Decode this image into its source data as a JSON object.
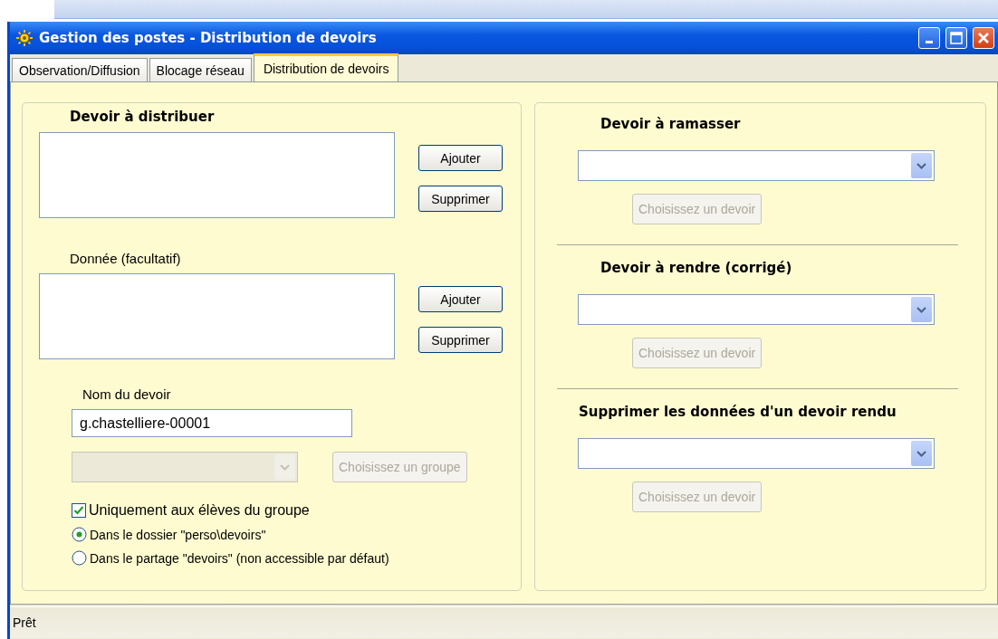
{
  "window": {
    "title": "Gestion des postes - Distribution de devoirs"
  },
  "tabs": [
    {
      "label": "Observation/Diffusion",
      "selected": false
    },
    {
      "label": "Blocage réseau",
      "selected": false
    },
    {
      "label": "Distribution de devoirs",
      "selected": true
    }
  ],
  "left_panel": {
    "file_lists": [
      {
        "label": "Devoir à distribuer",
        "kind": "heading",
        "buttons": [
          "Ajouter",
          "Supprimer"
        ]
      },
      {
        "label": "Donnée (facultatif)",
        "kind": "label",
        "buttons": [
          "Ajouter",
          "Supprimer"
        ]
      }
    ],
    "name_label": "Nom du devoir",
    "name_value": "g.chastelliere-00001",
    "group_select": {
      "disabled": true
    },
    "group_button": {
      "label": "Choisissez un groupe",
      "disabled": true
    },
    "checkbox": {
      "label": "Uniquement aux élèves du groupe",
      "checked": true
    },
    "radios": [
      {
        "label": "Dans le dossier \"perso\\devoirs\"",
        "selected": true
      },
      {
        "label": "Dans le partage \"devoirs\" (non accessible par défaut)",
        "selected": false
      }
    ]
  },
  "right_panel": {
    "sections": [
      {
        "heading": "Devoir à ramasser",
        "indent": true,
        "select": {
          "disabled": false
        },
        "button": {
          "label": "Choisissez un devoir",
          "disabled": true
        }
      },
      {
        "heading": "Devoir à rendre (corrigé)",
        "indent": true,
        "select": {
          "disabled": false
        },
        "button": {
          "label": "Choisissez un devoir",
          "disabled": true
        }
      },
      {
        "heading": "Supprimer  les données d'un devoir rendu",
        "indent": false,
        "select": {
          "disabled": false
        },
        "button": {
          "label": "Choisissez un devoir",
          "disabled": true
        }
      }
    ]
  },
  "status_bar": "Prêt"
}
